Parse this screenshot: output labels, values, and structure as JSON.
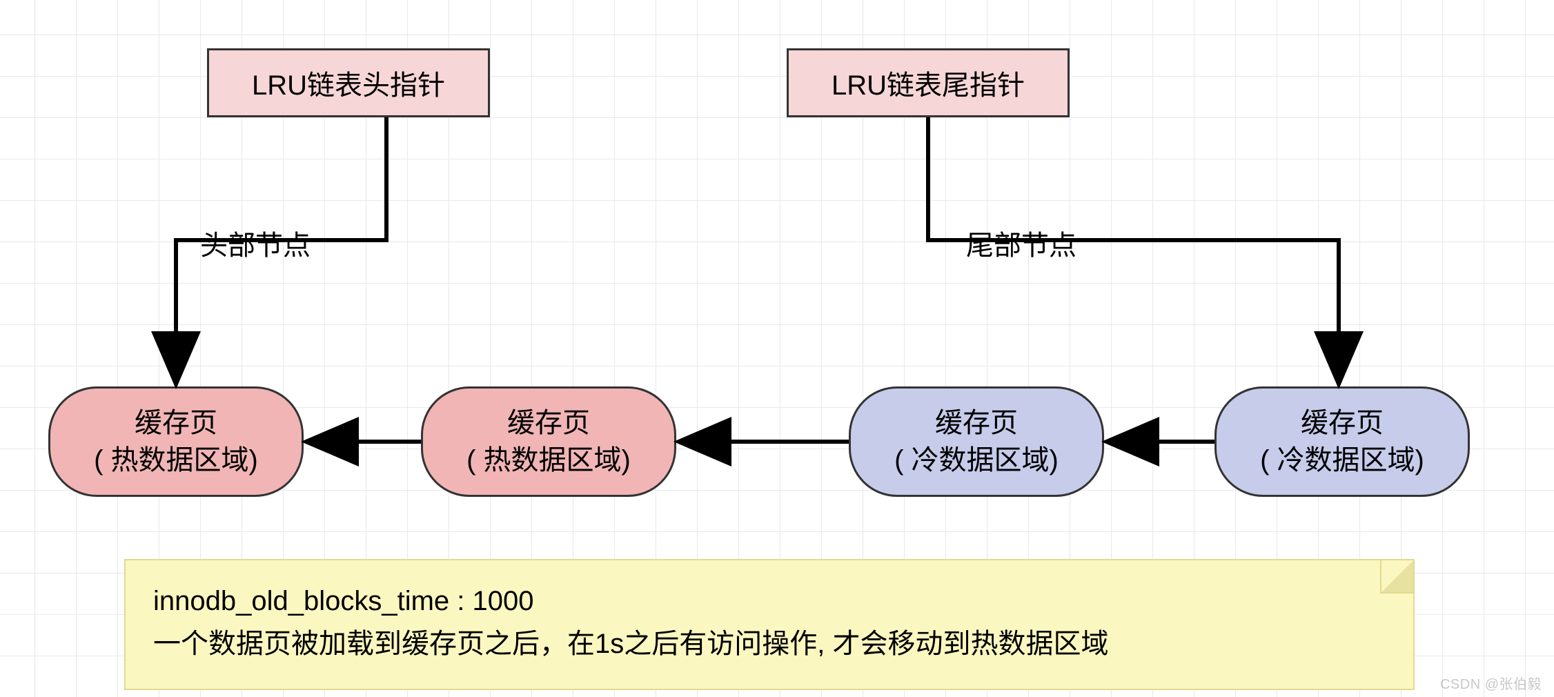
{
  "headers": {
    "head_ptr": "LRU链表头指针",
    "tail_ptr": "LRU链表尾指针"
  },
  "labels": {
    "head_node": "头部节点",
    "tail_node": "尾部节点"
  },
  "nodes": [
    {
      "title": "缓存页",
      "subtitle": "( 热数据区域)",
      "zone": "hot"
    },
    {
      "title": "缓存页",
      "subtitle": "( 热数据区域)",
      "zone": "hot"
    },
    {
      "title": "缓存页",
      "subtitle": "( 冷数据区域)",
      "zone": "cold"
    },
    {
      "title": "缓存页",
      "subtitle": "( 冷数据区域)",
      "zone": "cold"
    }
  ],
  "note": {
    "line1": "innodb_old_blocks_time  :  1000",
    "line2": "一个数据页被加载到缓存页之后，在1s之后有访问操作, 才会移动到热数据区域"
  },
  "watermark": "CSDN @张伯毅"
}
